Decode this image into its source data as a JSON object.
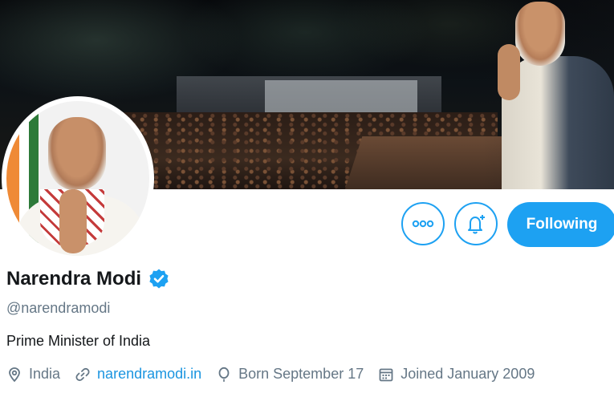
{
  "profile": {
    "display_name": "Narendra Modi",
    "handle": "@narendramodi",
    "bio": "Prime Minister of India",
    "verified": true,
    "location": "India",
    "website": "narendramodi.in",
    "birthday": "Born September 17",
    "joined": "Joined January 2009"
  },
  "actions": {
    "follow_label": "Following",
    "more_icon": "more-icon",
    "notifications_icon": "bell-plus-icon"
  },
  "colors": {
    "accent": "#1da1f2",
    "link": "#1b95e0",
    "muted": "#657786",
    "text": "#14171a"
  }
}
